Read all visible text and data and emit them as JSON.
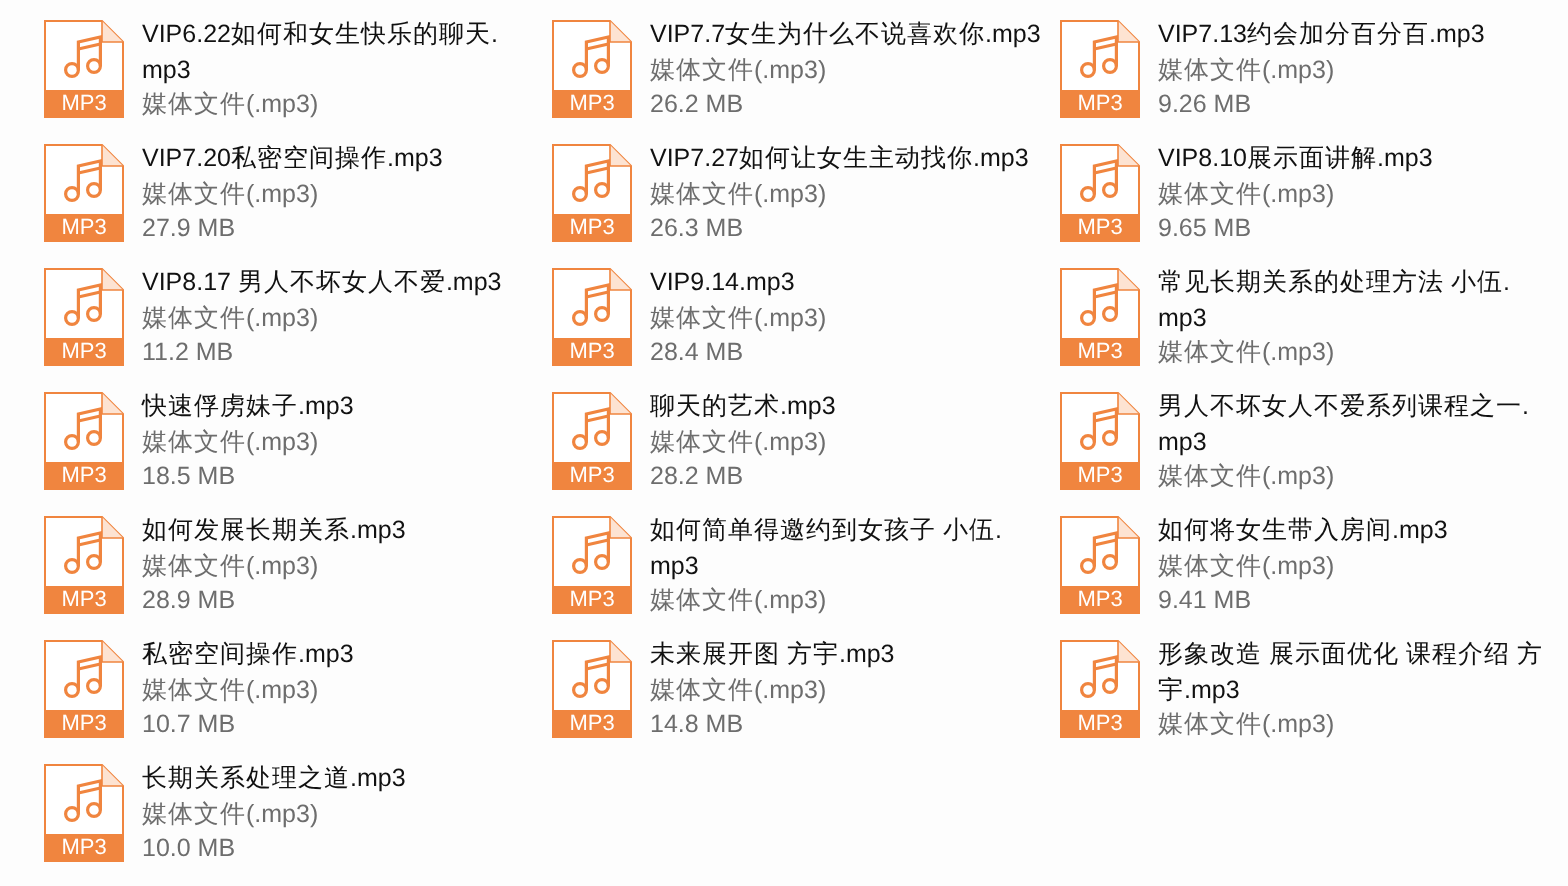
{
  "files": [
    {
      "name_lines": [
        "VIP6.22如何和女生快乐的聊天.",
        "mp3"
      ],
      "type": "媒体文件(.mp3)",
      "badge": "MP3"
    },
    {
      "name_lines": [
        "VIP7.7女生为什么不说喜欢你.mp3"
      ],
      "type": "媒体文件(.mp3)",
      "size": "26.2 MB",
      "badge": "MP3"
    },
    {
      "name_lines": [
        "VIP7.13约会加分百分百.mp3"
      ],
      "type": "媒体文件(.mp3)",
      "size": "9.26 MB",
      "badge": "MP3"
    },
    {
      "name_lines": [
        "VIP7.20私密空间操作.mp3"
      ],
      "type": "媒体文件(.mp3)",
      "size": "27.9 MB",
      "badge": "MP3"
    },
    {
      "name_lines": [
        "VIP7.27如何让女生主动找你.mp3"
      ],
      "type": "媒体文件(.mp3)",
      "size": "26.3 MB",
      "badge": "MP3"
    },
    {
      "name_lines": [
        "VIP8.10展示面讲解.mp3"
      ],
      "type": "媒体文件(.mp3)",
      "size": "9.65 MB",
      "badge": "MP3"
    },
    {
      "name_lines": [
        "VIP8.17 男人不坏女人不爱.mp3"
      ],
      "type": "媒体文件(.mp3)",
      "size": "11.2 MB",
      "badge": "MP3"
    },
    {
      "name_lines": [
        "VIP9.14.mp3"
      ],
      "type": "媒体文件(.mp3)",
      "size": "28.4 MB",
      "badge": "MP3"
    },
    {
      "name_lines": [
        "常见长期关系的处理方法 小伍.",
        "mp3"
      ],
      "type": "媒体文件(.mp3)",
      "badge": "MP3"
    },
    {
      "name_lines": [
        "快速俘虏妹子.mp3"
      ],
      "type": "媒体文件(.mp3)",
      "size": "18.5 MB",
      "badge": "MP3"
    },
    {
      "name_lines": [
        "聊天的艺术.mp3"
      ],
      "type": "媒体文件(.mp3)",
      "size": "28.2 MB",
      "badge": "MP3"
    },
    {
      "name_lines": [
        "男人不坏女人不爱系列课程之一.",
        "mp3"
      ],
      "type": "媒体文件(.mp3)",
      "badge": "MP3"
    },
    {
      "name_lines": [
        "如何发展长期关系.mp3"
      ],
      "type": "媒体文件(.mp3)",
      "size": "28.9 MB",
      "badge": "MP3"
    },
    {
      "name_lines": [
        "如何简单得邀约到女孩子 小伍.",
        "mp3"
      ],
      "type": "媒体文件(.mp3)",
      "badge": "MP3"
    },
    {
      "name_lines": [
        "如何将女生带入房间.mp3"
      ],
      "type": "媒体文件(.mp3)",
      "size": "9.41 MB",
      "badge": "MP3"
    },
    {
      "name_lines": [
        "私密空间操作.mp3"
      ],
      "type": "媒体文件(.mp3)",
      "size": "10.7 MB",
      "badge": "MP3"
    },
    {
      "name_lines": [
        "未来展开图 方宇.mp3"
      ],
      "type": "媒体文件(.mp3)",
      "size": "14.8 MB",
      "badge": "MP3"
    },
    {
      "name_lines": [
        "形象改造 展示面优化 课程介绍 方",
        "宇.mp3"
      ],
      "type": "媒体文件(.mp3)",
      "badge": "MP3"
    },
    {
      "name_lines": [
        "长期关系处理之道.mp3"
      ],
      "type": "媒体文件(.mp3)",
      "size": "10.0 MB",
      "badge": "MP3"
    }
  ]
}
